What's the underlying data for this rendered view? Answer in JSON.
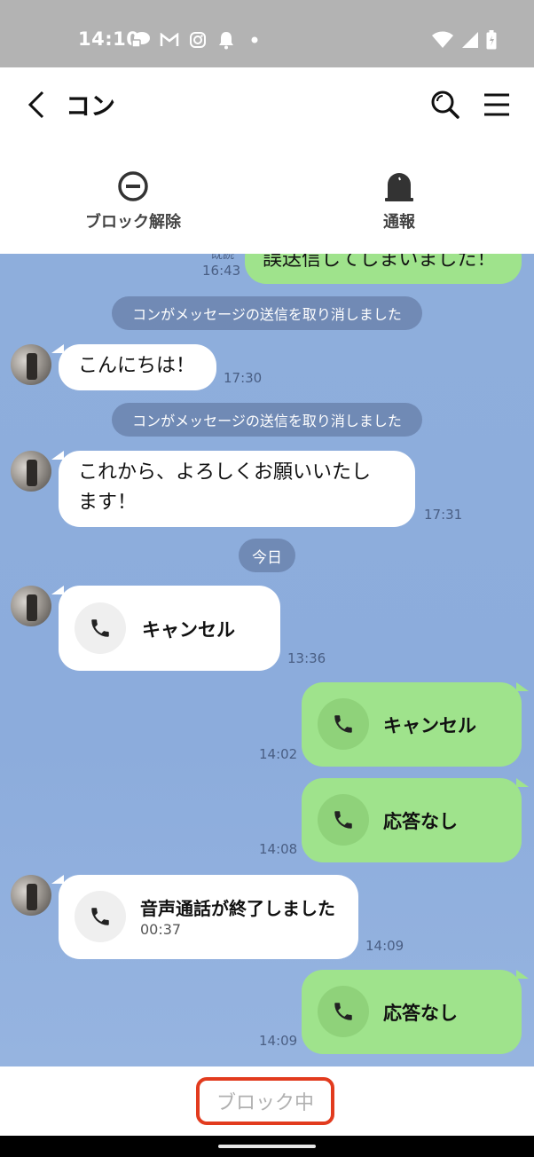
{
  "status_bar": {
    "time": "14:10",
    "icons_left": [
      "chat-bubble-icon",
      "gmail-icon",
      "instagram-icon",
      "notification-bell-icon",
      "dot-icon"
    ],
    "icons_right": [
      "wifi-icon",
      "signal-icon",
      "battery-icon"
    ]
  },
  "header": {
    "title": "コン",
    "back_icon": "chevron-left-icon",
    "search_icon": "search-icon",
    "menu_icon": "hamburger-menu-icon"
  },
  "actions": {
    "unblock_label": "ブロック解除",
    "report_label": "通報"
  },
  "chat": {
    "messages": [
      {
        "type": "outgoing_text",
        "text": "誤送信してしまいました！",
        "read": "既読",
        "time": "16:43"
      },
      {
        "type": "system",
        "text": "コンがメッセージの送信を取り消しました"
      },
      {
        "type": "incoming_text",
        "text": "こんにちは！",
        "time": "17:30"
      },
      {
        "type": "system",
        "text": "コンがメッセージの送信を取り消しました"
      },
      {
        "type": "incoming_text",
        "text_line1": "これから、よろしくお願いいたし",
        "text_line2": "ます！",
        "time": "17:31"
      },
      {
        "type": "date",
        "text": "今日"
      },
      {
        "type": "incoming_call",
        "label": "キャンセル",
        "time": "13:36"
      },
      {
        "type": "outgoing_call",
        "label": "キャンセル",
        "time": "14:02"
      },
      {
        "type": "outgoing_call",
        "label": "応答なし",
        "time": "14:08"
      },
      {
        "type": "incoming_call",
        "label": "音声通話が終了しました",
        "duration": "00:37",
        "time": "14:09"
      },
      {
        "type": "outgoing_call",
        "label": "応答なし",
        "time": "14:09"
      }
    ]
  },
  "footer": {
    "blocked_text": "ブロック中"
  },
  "colors": {
    "chat_bg": "#8eaedc",
    "outgoing_bubble": "#9fe38c",
    "incoming_bubble": "#ffffff",
    "highlight_border": "#e23b1e"
  }
}
